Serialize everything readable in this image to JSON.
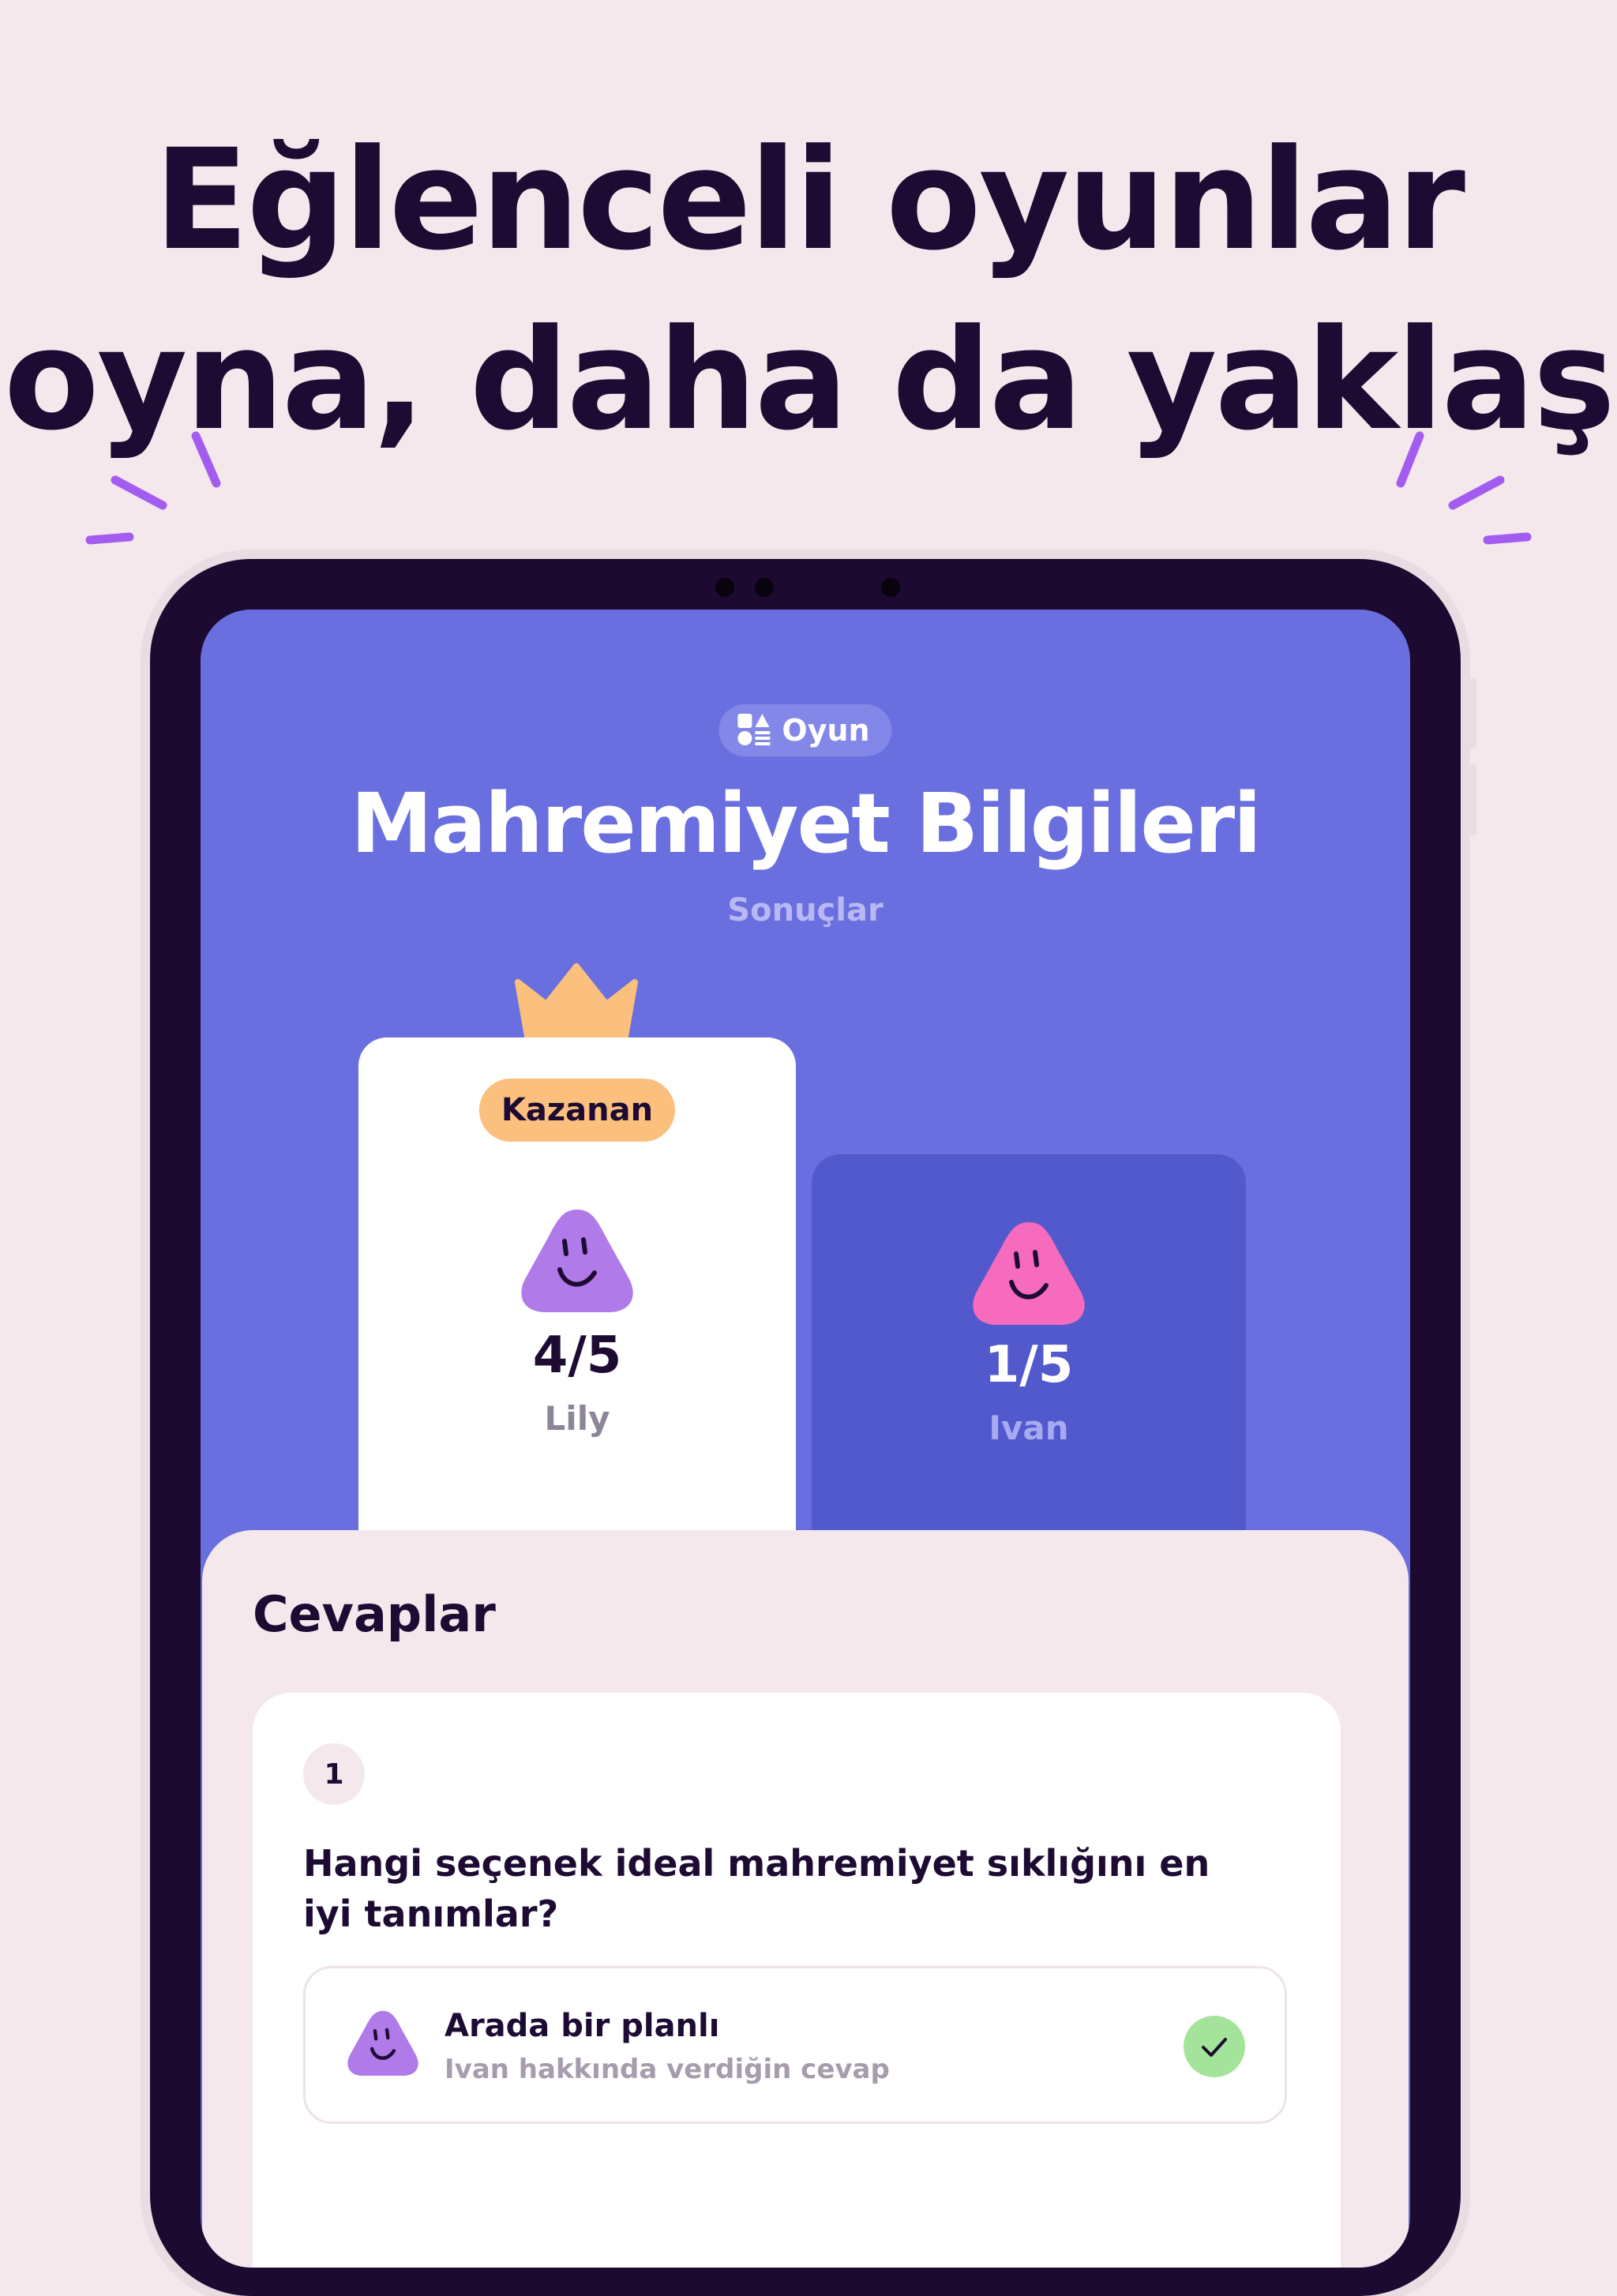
{
  "headline": {
    "line1": "Eğlenceli oyunlar",
    "line2": "oyna, daha da yaklaş"
  },
  "screen": {
    "pill_label": "Oyun",
    "pill_icon": "games-icon",
    "title": "Mahremiyet Bilgileri",
    "subtitle": "Sonuçlar"
  },
  "results": {
    "winner": {
      "badge": "Kazanan",
      "score": "4/5",
      "name": "Lily",
      "avatar_color": "#b07ae8"
    },
    "loser": {
      "score": "1/5",
      "name": "Ivan",
      "avatar_color": "#f66bbd"
    }
  },
  "answers": {
    "title": "Cevaplar",
    "question": {
      "number": "1",
      "text": "Hangi seçenek ideal mahremiyet sıklığını en iyi tanımlar?",
      "answer_label": "Arada bir planlı",
      "answer_sub": "Ivan hakkında verdiğin cevap",
      "status_icon": "check-icon"
    }
  },
  "colors": {
    "background": "#f5e8ec",
    "screen": "#6a6fe0",
    "ink": "#1e0b33",
    "badge": "#fbbf7e",
    "accent_spark": "#a45cf0",
    "correct": "#a4e39a"
  }
}
